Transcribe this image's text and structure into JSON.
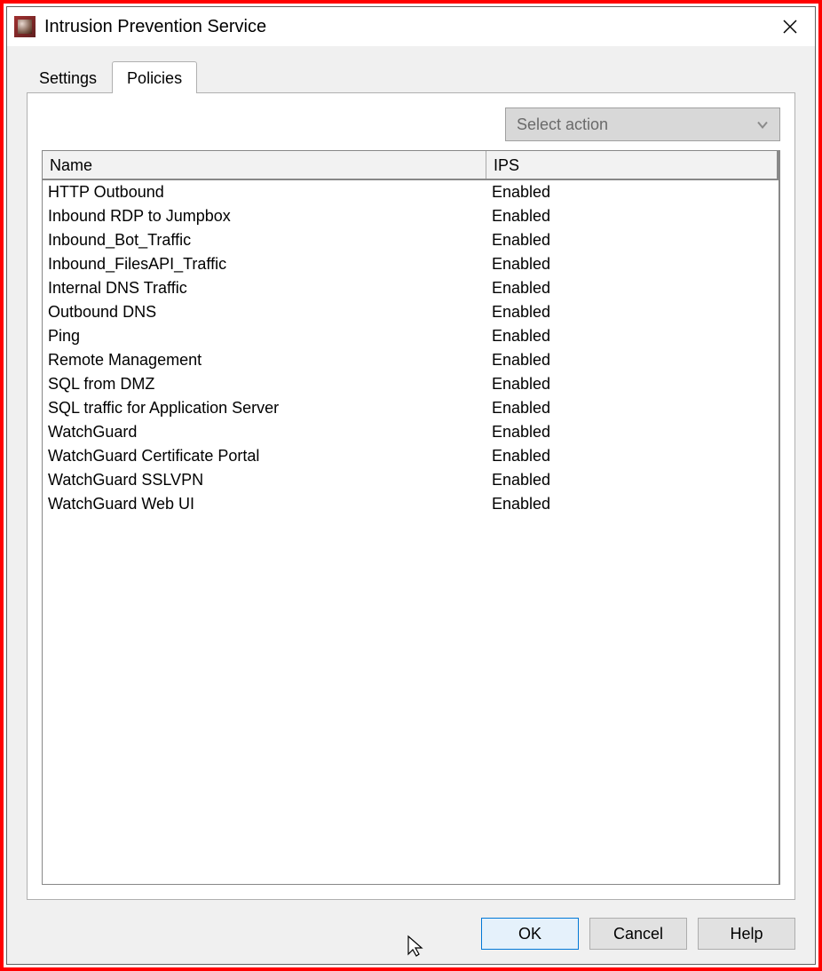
{
  "window": {
    "title": "Intrusion Prevention Service"
  },
  "tabs": {
    "settings": "Settings",
    "policies": "Policies",
    "active": "policies"
  },
  "action_dropdown": {
    "placeholder": "Select action"
  },
  "table": {
    "headers": {
      "name": "Name",
      "ips": "IPS"
    },
    "rows": [
      {
        "name": "HTTP Outbound",
        "ips": "Enabled"
      },
      {
        "name": "Inbound RDP to Jumpbox",
        "ips": "Enabled"
      },
      {
        "name": "Inbound_Bot_Traffic",
        "ips": "Enabled"
      },
      {
        "name": "Inbound_FilesAPI_Traffic",
        "ips": "Enabled"
      },
      {
        "name": "Internal DNS Traffic",
        "ips": "Enabled"
      },
      {
        "name": "Outbound DNS",
        "ips": "Enabled"
      },
      {
        "name": "Ping",
        "ips": "Enabled"
      },
      {
        "name": "Remote Management",
        "ips": "Enabled"
      },
      {
        "name": "SQL from DMZ",
        "ips": "Enabled"
      },
      {
        "name": "SQL traffic for Application Server",
        "ips": "Enabled"
      },
      {
        "name": "WatchGuard",
        "ips": "Enabled"
      },
      {
        "name": "WatchGuard Certificate Portal",
        "ips": "Enabled"
      },
      {
        "name": "WatchGuard SSLVPN",
        "ips": "Enabled"
      },
      {
        "name": "WatchGuard Web UI",
        "ips": "Enabled"
      }
    ]
  },
  "buttons": {
    "ok": "OK",
    "cancel": "Cancel",
    "help": "Help"
  }
}
